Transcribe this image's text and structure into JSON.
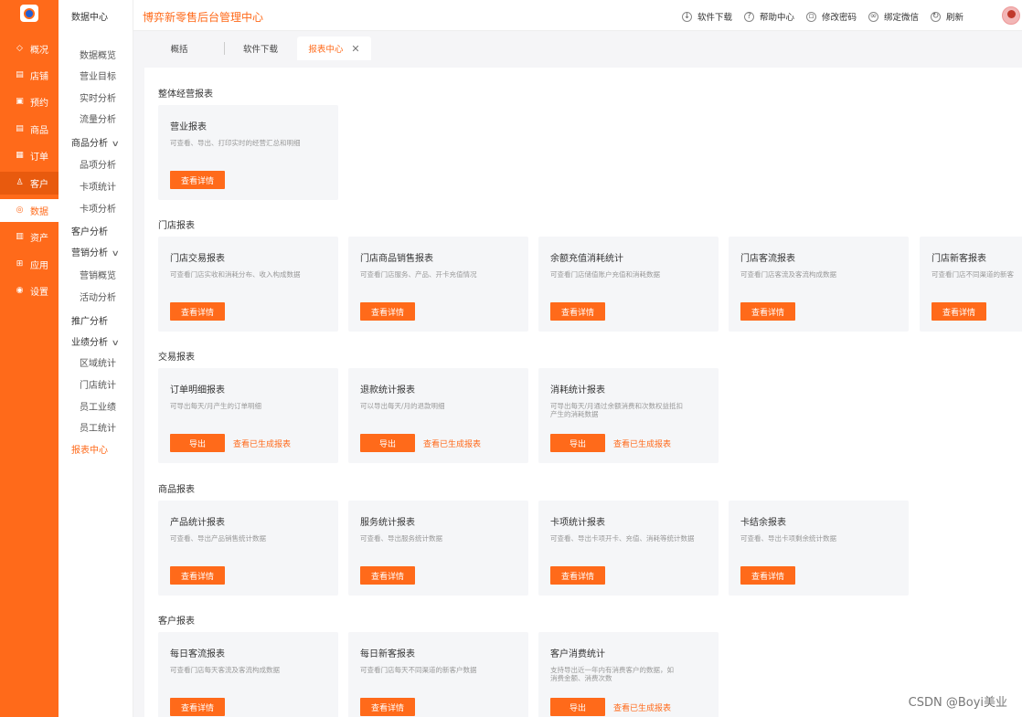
{
  "rail": {
    "items": [
      {
        "icon": "diamond-icon",
        "glyph": "◇",
        "label": "概况"
      },
      {
        "icon": "store-icon",
        "glyph": "▤",
        "label": "店铺"
      },
      {
        "icon": "calendar-icon",
        "glyph": "▣",
        "label": "预约"
      },
      {
        "icon": "goods-icon",
        "glyph": "▤",
        "label": "商品"
      },
      {
        "icon": "order-icon",
        "glyph": "▦",
        "label": "订单"
      },
      {
        "icon": "user-icon",
        "glyph": "♙",
        "label": "客户"
      },
      {
        "icon": "data-icon",
        "glyph": "◎",
        "label": "数据"
      },
      {
        "icon": "asset-icon",
        "glyph": "▥",
        "label": "资产"
      },
      {
        "icon": "apps-icon",
        "glyph": "⊞",
        "label": "应用"
      },
      {
        "icon": "settings-icon",
        "glyph": "◉",
        "label": "设置"
      }
    ]
  },
  "submenu": {
    "header": "数据中心",
    "items": [
      {
        "label": "数据概览",
        "kind": "child"
      },
      {
        "label": "营业目标",
        "kind": "child"
      },
      {
        "label": "实时分析",
        "kind": "child"
      },
      {
        "label": "流量分析",
        "kind": "child"
      },
      {
        "label": "商品分析",
        "kind": "group"
      },
      {
        "label": "品项分析",
        "kind": "child"
      },
      {
        "label": "卡项统计",
        "kind": "child"
      },
      {
        "label": "卡项分析",
        "kind": "child"
      },
      {
        "label": "客户分析",
        "kind": "head"
      },
      {
        "label": "营销分析",
        "kind": "group"
      },
      {
        "label": "营销概览",
        "kind": "child"
      },
      {
        "label": "活动分析",
        "kind": "child"
      },
      {
        "label": "推广分析",
        "kind": "head"
      },
      {
        "label": "业绩分析",
        "kind": "group"
      },
      {
        "label": "区域统计",
        "kind": "child"
      },
      {
        "label": "门店统计",
        "kind": "child"
      },
      {
        "label": "员工业绩",
        "kind": "child"
      },
      {
        "label": "员工统计",
        "kind": "child"
      },
      {
        "label": "报表中心",
        "kind": "current"
      }
    ]
  },
  "header": {
    "title": "博弈新零售后台管理中心",
    "actions": [
      {
        "icon": "download-icon",
        "glyph": "↓",
        "label": "软件下载"
      },
      {
        "icon": "help-icon",
        "glyph": "?",
        "label": "帮助中心"
      },
      {
        "icon": "lock-icon",
        "glyph": "▫",
        "label": "修改密码"
      },
      {
        "icon": "wechat-icon",
        "glyph": "∞",
        "label": "绑定微信"
      },
      {
        "icon": "refresh-icon",
        "glyph": "↻",
        "label": "刷新"
      }
    ]
  },
  "tabs": [
    {
      "label": "概括"
    },
    {
      "label": "软件下载"
    },
    {
      "label": "报表中心",
      "close": "✕"
    }
  ],
  "sections": [
    {
      "title": "整体经营报表",
      "cards": [
        {
          "title": "营业报表",
          "desc": "可查看、导出、打印实时的经营汇总和明细",
          "button": "查看详情"
        }
      ]
    },
    {
      "title": "门店报表",
      "cards": [
        {
          "title": "门店交易报表",
          "desc": "可查看门店实收和消耗分布、收入构成数据",
          "button": "查看详情"
        },
        {
          "title": "门店商品销售报表",
          "desc": "可查看门店服务、产品、开卡充值情况",
          "button": "查看详情"
        },
        {
          "title": "余额充值消耗统计",
          "desc": "可查看门店储值账户充值和消耗数据",
          "button": "查看详情"
        },
        {
          "title": "门店客流报表",
          "desc": "可查看门店客流及客流构成数据",
          "button": "查看详情"
        },
        {
          "title": "门店新客报表",
          "desc": "可查看门店不同渠道的新客",
          "button": "查看详情"
        }
      ]
    },
    {
      "title": "交易报表",
      "cards": [
        {
          "title": "订单明细报表",
          "desc": "可导出每天/月产生的订单明细",
          "button": "导出",
          "link": "查看已生成报表"
        },
        {
          "title": "退款统计报表",
          "desc": "可以导出每天/月的退款明细",
          "button": "导出",
          "link": "查看已生成报表"
        },
        {
          "title": "消耗统计报表",
          "desc": "可导出每天/月通过余额消费和次数权益抵扣产生的消耗数据",
          "button": "导出",
          "link": "查看已生成报表"
        }
      ]
    },
    {
      "title": "商品报表",
      "cards": [
        {
          "title": "产品统计报表",
          "desc": "可查看、导出产品销售统计数据",
          "button": "查看详情"
        },
        {
          "title": "服务统计报表",
          "desc": "可查看、导出服务统计数据",
          "button": "查看详情"
        },
        {
          "title": "卡项统计报表",
          "desc": "可查看、导出卡项开卡、充值、消耗等统计数据",
          "button": "查看详情"
        },
        {
          "title": "卡结余报表",
          "desc": "可查看、导出卡项剩余统计数据",
          "button": "查看详情"
        }
      ]
    },
    {
      "title": "客户报表",
      "cards": [
        {
          "title": "每日客流报表",
          "desc": "可查看门店每天客流及客流构成数据",
          "button": "查看详情"
        },
        {
          "title": "每日新客报表",
          "desc": "可查看门店每天不同渠道的新客户数据",
          "button": "查看详情"
        },
        {
          "title": "客户消费统计",
          "desc": "支持导出近一年内有消费客户的数据，如消费金额、消费次数",
          "button": "导出",
          "link": "查看已生成报表"
        }
      ]
    }
  ],
  "watermark": "CSDN @Boyi美业"
}
